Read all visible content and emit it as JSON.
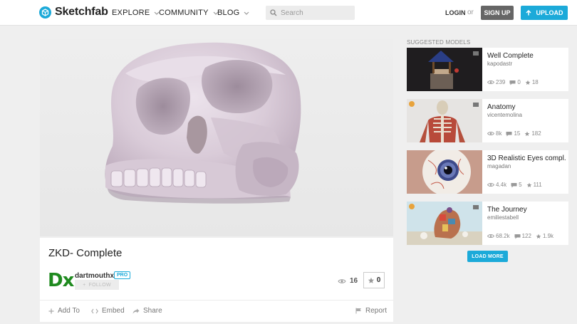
{
  "brand": {
    "name": "Sketchfab",
    "accent": "#1caad9"
  },
  "nav": {
    "explore": "EXPLORE",
    "community": "COMMUNITY",
    "blog": "BLOG"
  },
  "search": {
    "placeholder": "Search"
  },
  "auth": {
    "login": "LOGIN",
    "or": "or",
    "signup": "SIGN UP",
    "upload": "UPLOAD"
  },
  "model": {
    "title": "ZKD- Complete",
    "author_initials": "Dx",
    "author": "dartmouthx",
    "badge": "PRO",
    "follow_label": "FOLLOW",
    "views": "16",
    "likes": "0",
    "actions": {
      "add_to": "Add To",
      "embed": "Embed",
      "share": "Share",
      "report": "Report"
    }
  },
  "sidebar": {
    "title": "SUGGESTED MODELS",
    "items": [
      {
        "title": "Well Complete",
        "author": "kapodastr",
        "views": "239",
        "comments": "0",
        "likes": "18"
      },
      {
        "title": "Anatomy",
        "author": "vicentemolina",
        "views": "8k",
        "comments": "15",
        "likes": "182"
      },
      {
        "title": "3D Realistic Eyes compl...",
        "author": "magadan",
        "views": "4.4k",
        "comments": "5",
        "likes": "111"
      },
      {
        "title": "The Journey",
        "author": "emiliestabell",
        "views": "68.2k",
        "comments": "122",
        "likes": "1.9k"
      }
    ],
    "load_more": "LOAD MORE"
  }
}
